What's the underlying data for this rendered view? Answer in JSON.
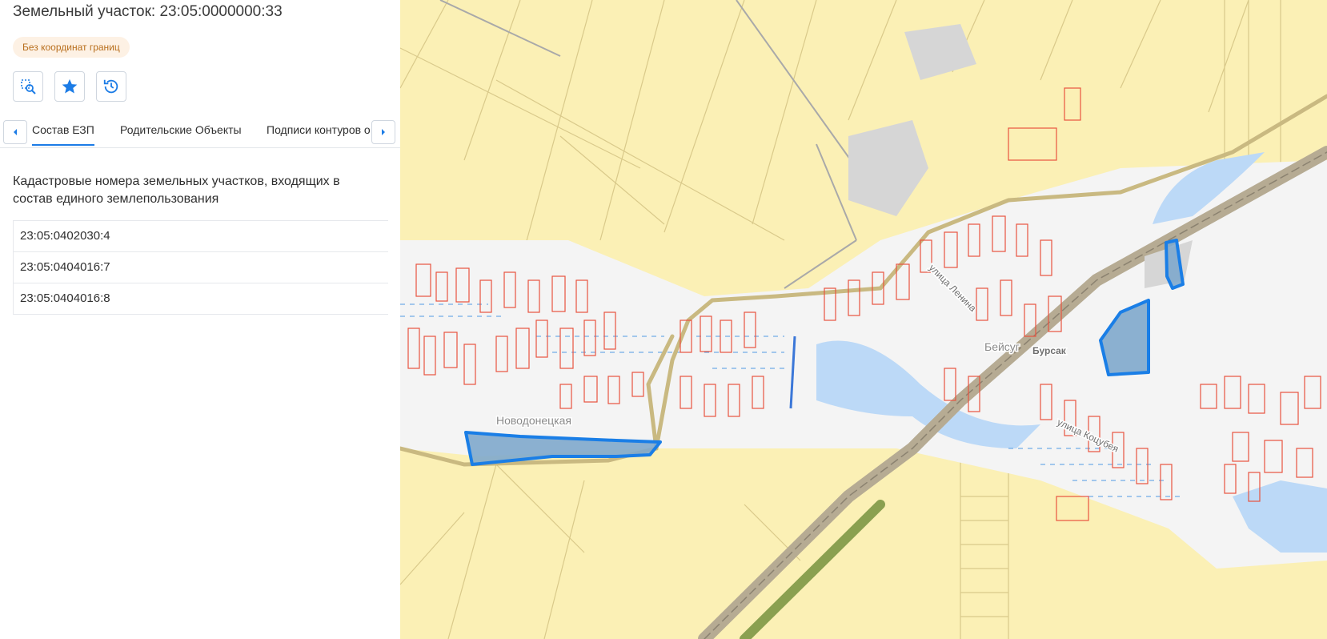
{
  "header": {
    "title": "Земельный участок: 23:05:0000000:33",
    "badge": "Без координат границ"
  },
  "toolbar": {
    "buttons": [
      {
        "icon": "select-area-search-icon"
      },
      {
        "icon": "star-icon"
      },
      {
        "icon": "history-icon"
      }
    ]
  },
  "tabs": [
    {
      "label": "Состав ЕЗП",
      "active": true
    },
    {
      "label": "Родительские Объекты",
      "active": false
    },
    {
      "label": "Подписи контуров о",
      "active": false
    }
  ],
  "section": {
    "title": "Кадастровые номера земельных участков, входящих в состав единого землепользования"
  },
  "parcels": [
    "23:05:0402030:4",
    "23:05:0404016:7",
    "23:05:0404016:8"
  ],
  "map": {
    "labels": {
      "village_west": "Новодонецкая",
      "village_east": "Бейсуг",
      "station": "Бурсак",
      "street_lenina": "улица Ленина",
      "street_kotsubeya": "улица Коцубея"
    },
    "colors": {
      "fields": "#fbf0b5",
      "field_lines": "#d9c98a",
      "settlement": "#f4f4f4",
      "buildings": "#e8533f",
      "water": "#bcd9f7",
      "highlight_fill": "#7fa8cc",
      "highlight_stroke": "#1a7ee6",
      "rail": "#b6ab93",
      "green": "#8aa050"
    }
  }
}
